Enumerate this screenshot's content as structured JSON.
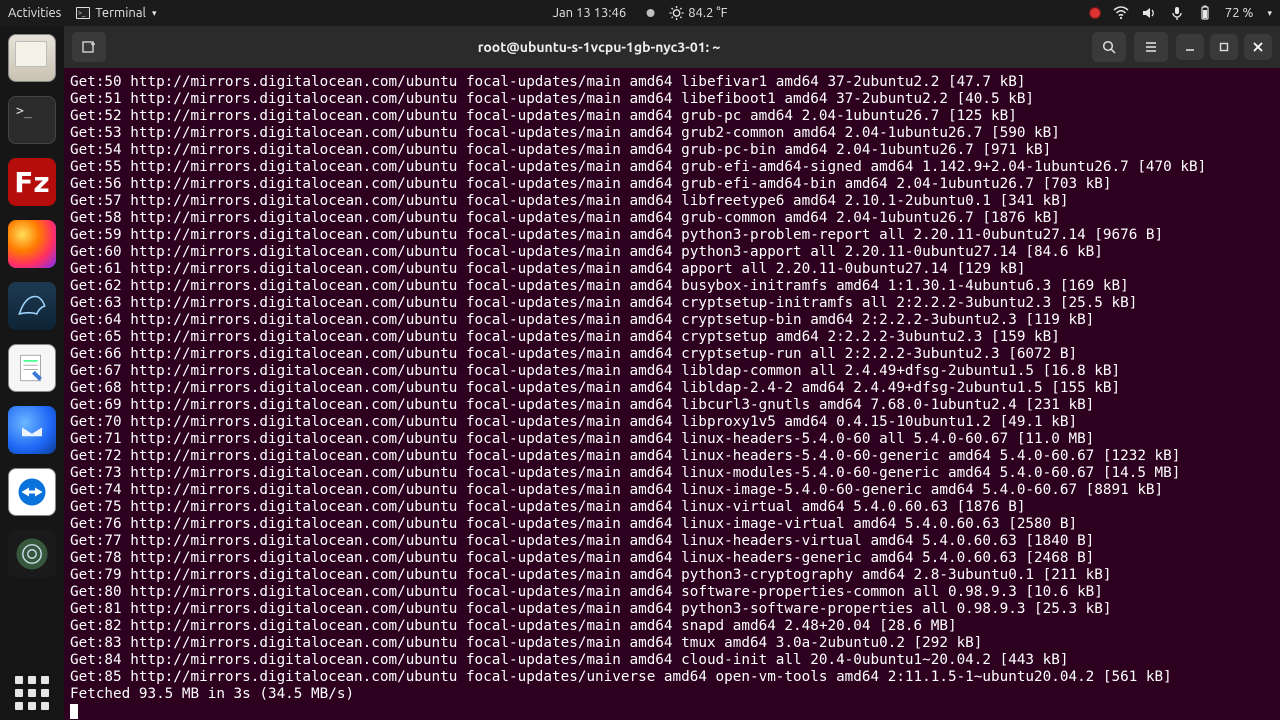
{
  "panel": {
    "activities": "Activities",
    "app_menu": "Terminal",
    "clock": "Jan 13  13:46",
    "temperature": "84.2 °F",
    "battery": "72 %"
  },
  "dock": {
    "items": [
      {
        "name": "files",
        "label": "Files"
      },
      {
        "name": "terminal",
        "label": "Terminal"
      },
      {
        "name": "filezilla",
        "label": "FileZilla",
        "glyph": "Fz"
      },
      {
        "name": "firefox",
        "label": "Firefox"
      },
      {
        "name": "mysql-workbench",
        "label": "MySQL Workbench"
      },
      {
        "name": "gedit",
        "label": "Text Editor"
      },
      {
        "name": "thunderbird",
        "label": "Thunderbird"
      },
      {
        "name": "teamviewer",
        "label": "TeamViewer",
        "glyph": "↔"
      },
      {
        "name": "obs",
        "label": "OBS Studio"
      }
    ],
    "show_apps": "Show Applications"
  },
  "terminal": {
    "title": "root@ubuntu-s-1vcpu-1gb-nyc3-01: ~",
    "base": "http://mirrors.digitalocean.com/ubuntu",
    "lines": [
      {
        "n": 50,
        "repo": "focal-updates/main amd64",
        "pkg": "libefivar1 amd64 37-2ubuntu2.2",
        "size": "47.7 kB"
      },
      {
        "n": 51,
        "repo": "focal-updates/main amd64",
        "pkg": "libefiboot1 amd64 37-2ubuntu2.2",
        "size": "40.5 kB"
      },
      {
        "n": 52,
        "repo": "focal-updates/main amd64",
        "pkg": "grub-pc amd64 2.04-1ubuntu26.7",
        "size": "125 kB"
      },
      {
        "n": 53,
        "repo": "focal-updates/main amd64",
        "pkg": "grub2-common amd64 2.04-1ubuntu26.7",
        "size": "590 kB"
      },
      {
        "n": 54,
        "repo": "focal-updates/main amd64",
        "pkg": "grub-pc-bin amd64 2.04-1ubuntu26.7",
        "size": "971 kB"
      },
      {
        "n": 55,
        "repo": "focal-updates/main amd64",
        "pkg": "grub-efi-amd64-signed amd64 1.142.9+2.04-1ubuntu26.7",
        "size": "470 kB"
      },
      {
        "n": 56,
        "repo": "focal-updates/main amd64",
        "pkg": "grub-efi-amd64-bin amd64 2.04-1ubuntu26.7",
        "size": "703 kB"
      },
      {
        "n": 57,
        "repo": "focal-updates/main amd64",
        "pkg": "libfreetype6 amd64 2.10.1-2ubuntu0.1",
        "size": "341 kB"
      },
      {
        "n": 58,
        "repo": "focal-updates/main amd64",
        "pkg": "grub-common amd64 2.04-1ubuntu26.7",
        "size": "1876 kB"
      },
      {
        "n": 59,
        "repo": "focal-updates/main amd64",
        "pkg": "python3-problem-report all 2.20.11-0ubuntu27.14",
        "size": "9676 B"
      },
      {
        "n": 60,
        "repo": "focal-updates/main amd64",
        "pkg": "python3-apport all 2.20.11-0ubuntu27.14",
        "size": "84.6 kB"
      },
      {
        "n": 61,
        "repo": "focal-updates/main amd64",
        "pkg": "apport all 2.20.11-0ubuntu27.14",
        "size": "129 kB"
      },
      {
        "n": 62,
        "repo": "focal-updates/main amd64",
        "pkg": "busybox-initramfs amd64 1:1.30.1-4ubuntu6.3",
        "size": "169 kB"
      },
      {
        "n": 63,
        "repo": "focal-updates/main amd64",
        "pkg": "cryptsetup-initramfs all 2:2.2.2-3ubuntu2.3",
        "size": "25.5 kB"
      },
      {
        "n": 64,
        "repo": "focal-updates/main amd64",
        "pkg": "cryptsetup-bin amd64 2:2.2.2-3ubuntu2.3",
        "size": "119 kB"
      },
      {
        "n": 65,
        "repo": "focal-updates/main amd64",
        "pkg": "cryptsetup amd64 2:2.2.2-3ubuntu2.3",
        "size": "159 kB"
      },
      {
        "n": 66,
        "repo": "focal-updates/main amd64",
        "pkg": "cryptsetup-run all 2:2.2.2-3ubuntu2.3",
        "size": "6072 B"
      },
      {
        "n": 67,
        "repo": "focal-updates/main amd64",
        "pkg": "libldap-common all 2.4.49+dfsg-2ubuntu1.5",
        "size": "16.8 kB"
      },
      {
        "n": 68,
        "repo": "focal-updates/main amd64",
        "pkg": "libldap-2.4-2 amd64 2.4.49+dfsg-2ubuntu1.5",
        "size": "155 kB"
      },
      {
        "n": 69,
        "repo": "focal-updates/main amd64",
        "pkg": "libcurl3-gnutls amd64 7.68.0-1ubuntu2.4",
        "size": "231 kB"
      },
      {
        "n": 70,
        "repo": "focal-updates/main amd64",
        "pkg": "libproxy1v5 amd64 0.4.15-10ubuntu1.2",
        "size": "49.1 kB"
      },
      {
        "n": 71,
        "repo": "focal-updates/main amd64",
        "pkg": "linux-headers-5.4.0-60 all 5.4.0-60.67",
        "size": "11.0 MB"
      },
      {
        "n": 72,
        "repo": "focal-updates/main amd64",
        "pkg": "linux-headers-5.4.0-60-generic amd64 5.4.0-60.67",
        "size": "1232 kB"
      },
      {
        "n": 73,
        "repo": "focal-updates/main amd64",
        "pkg": "linux-modules-5.4.0-60-generic amd64 5.4.0-60.67",
        "size": "14.5 MB"
      },
      {
        "n": 74,
        "repo": "focal-updates/main amd64",
        "pkg": "linux-image-5.4.0-60-generic amd64 5.4.0-60.67",
        "size": "8891 kB"
      },
      {
        "n": 75,
        "repo": "focal-updates/main amd64",
        "pkg": "linux-virtual amd64 5.4.0.60.63",
        "size": "1876 B"
      },
      {
        "n": 76,
        "repo": "focal-updates/main amd64",
        "pkg": "linux-image-virtual amd64 5.4.0.60.63",
        "size": "2580 B"
      },
      {
        "n": 77,
        "repo": "focal-updates/main amd64",
        "pkg": "linux-headers-virtual amd64 5.4.0.60.63",
        "size": "1840 B"
      },
      {
        "n": 78,
        "repo": "focal-updates/main amd64",
        "pkg": "linux-headers-generic amd64 5.4.0.60.63",
        "size": "2468 B"
      },
      {
        "n": 79,
        "repo": "focal-updates/main amd64",
        "pkg": "python3-cryptography amd64 2.8-3ubuntu0.1",
        "size": "211 kB"
      },
      {
        "n": 80,
        "repo": "focal-updates/main amd64",
        "pkg": "software-properties-common all 0.98.9.3",
        "size": "10.6 kB"
      },
      {
        "n": 81,
        "repo": "focal-updates/main amd64",
        "pkg": "python3-software-properties all 0.98.9.3",
        "size": "25.3 kB"
      },
      {
        "n": 82,
        "repo": "focal-updates/main amd64",
        "pkg": "snapd amd64 2.48+20.04",
        "size": "28.6 MB"
      },
      {
        "n": 83,
        "repo": "focal-updates/main amd64",
        "pkg": "tmux amd64 3.0a-2ubuntu0.2",
        "size": "292 kB"
      },
      {
        "n": 84,
        "repo": "focal-updates/main amd64",
        "pkg": "cloud-init all 20.4-0ubuntu1~20.04.2",
        "size": "443 kB"
      },
      {
        "n": 85,
        "repo": "focal-updates/universe amd64",
        "pkg": "open-vm-tools amd64 2:11.1.5-1~ubuntu20.04.2",
        "size": "561 kB"
      }
    ],
    "summary": "Fetched 93.5 MB in 3s (34.5 MB/s)"
  }
}
